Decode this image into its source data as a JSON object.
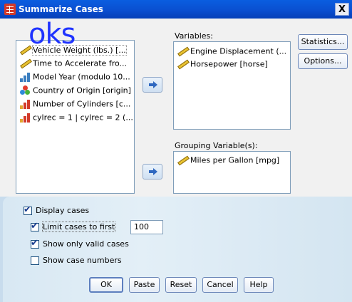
{
  "window": {
    "title": "Summarize Cases",
    "close_symbol": "X"
  },
  "source_list": {
    "items": [
      {
        "label": "Vehicle Weight (lbs.) [...",
        "icon": "ruler-icon"
      },
      {
        "label": "Time to Accelerate fro...",
        "icon": "ruler-icon"
      },
      {
        "label": "Model Year (modulo 10...",
        "icon": "bars-icon"
      },
      {
        "label": "Country of Origin [origin]",
        "icon": "balls-icon"
      },
      {
        "label": "Number of Cylinders [c...",
        "icon": "bars-icon"
      },
      {
        "label": "cylrec = 1 | cylrec = 2 (...",
        "icon": "bars-icon"
      }
    ]
  },
  "variables": {
    "label": "Variables:",
    "items": [
      {
        "label": "Engine Displacement (...",
        "icon": "ruler-icon"
      },
      {
        "label": "Horsepower [horse]",
        "icon": "ruler-icon"
      }
    ]
  },
  "grouping": {
    "label": "Grouping Variable(s):",
    "items": [
      {
        "label": "Miles per Gallon [mpg]",
        "icon": "ruler-icon"
      }
    ]
  },
  "side_buttons": {
    "statistics": "Statistics...",
    "options": "Options..."
  },
  "checkboxes": {
    "display_cases": {
      "label": "Display cases",
      "checked": true
    },
    "limit_cases": {
      "label": "Limit cases to first",
      "checked": true,
      "value": "100"
    },
    "valid_only": {
      "label": "Show only valid cases",
      "checked": true
    },
    "case_numbers": {
      "label": "Show case numbers",
      "checked": false
    }
  },
  "bottom_buttons": {
    "ok": "OK",
    "paste": "Paste",
    "reset": "Reset",
    "cancel": "Cancel",
    "help": "Help"
  },
  "watermark": {
    "text": "oks"
  },
  "colors": {
    "titlebar": "#0a4fd0",
    "accent": "#2f68c0",
    "watermark": "#1f33ff"
  }
}
